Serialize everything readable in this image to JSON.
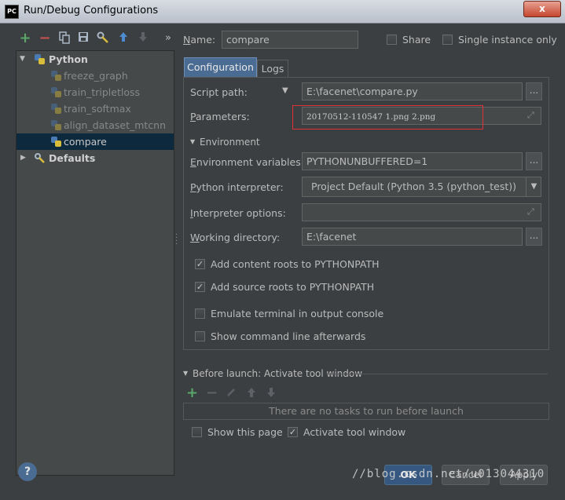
{
  "window": {
    "title": "Run/Debug Configurations",
    "app_icon": "PC",
    "close_glyph": "x"
  },
  "toolbar": {
    "icons": [
      "plus-icon",
      "minus-icon",
      "copy-icon",
      "save-icon",
      "wrench-icon",
      "arrow-up-icon",
      "arrow-down-icon",
      "more-icon"
    ],
    "more_glyph": "»"
  },
  "tree": {
    "python_label": "Python",
    "items": [
      "freeze_graph",
      "train_tripletloss",
      "train_softmax",
      "align_dataset_mtcnn",
      "compare"
    ],
    "defaults_label": "Defaults"
  },
  "header": {
    "name_label": "Name:",
    "name_value": "compare",
    "share_label": "Share",
    "single_instance_label": "Single instance only"
  },
  "tabs": {
    "configuration": "Configuration",
    "logs": "Logs"
  },
  "config": {
    "script_path_label": "Script path:",
    "script_path_value": "E:\\facenet\\compare.py",
    "parameters_label": "Parameters:",
    "parameters_value": "20170512-110547 1.png 2.png",
    "environment_label": "Environment",
    "env_vars_label": "Environment variables:",
    "env_vars_value": "PYTHONUNBUFFERED=1",
    "interpreter_label": "Python interpreter:",
    "interpreter_value": "Project Default (Python 3.5 (python_test))",
    "interp_options_label": "Interpreter options:",
    "interp_options_value": "",
    "working_dir_label": "Working directory:",
    "working_dir_value": "E:\\facenet",
    "dots": "...",
    "checks": [
      {
        "label": "Add content roots to PYTHONPATH",
        "checked": true
      },
      {
        "label": "Add source roots to PYTHONPATH",
        "checked": true
      },
      {
        "label": "Emulate terminal in output console",
        "checked": false
      },
      {
        "label": "Show command line afterwards",
        "checked": false
      }
    ]
  },
  "before_launch": {
    "label": "Before launch: Activate tool window",
    "empty_text": "There are no tasks to run before launch",
    "show_page_label": "Show this page",
    "activate_label": "Activate tool window"
  },
  "buttons": {
    "help": "?",
    "ok": "OK",
    "cancel": "Cancel",
    "apply": "Apply"
  },
  "watermark": "//blog.csdn.net/u013044310",
  "colors": {
    "accent": "#4a6c93",
    "ok_button": "#365880",
    "selection": "#0d293e",
    "highlight_box": "#e0303a",
    "add_green": "#59a869"
  }
}
